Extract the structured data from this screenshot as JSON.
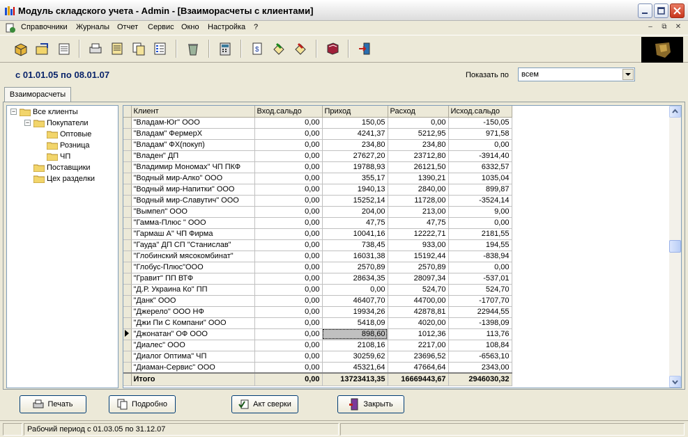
{
  "window": {
    "title": "Модуль складского учета - Admin - [Взаиморасчеты с клиентами]"
  },
  "menu": {
    "items": [
      "Справочники",
      "Журналы",
      "Отчет",
      "Сервис",
      "Окно",
      "Настройка",
      "?"
    ]
  },
  "period": {
    "text": "с 01.01.05 по 08.01.07",
    "show_label": "Показать по",
    "show_value": "всем"
  },
  "tab": {
    "label": "Взаиморасчеты"
  },
  "tree": {
    "root": "Все клиенты",
    "nodes": [
      "Покупатели",
      "Оптовые",
      "Розница",
      "ЧП",
      "Поставщики",
      "Цех разделки"
    ]
  },
  "grid": {
    "columns": [
      "Клиент",
      "Вход.сальдо",
      "Приход",
      "Расход",
      "Исход.сальдо"
    ],
    "rows": [
      [
        "\"Владам-Юг\" ООО",
        "0,00",
        "150,05",
        "0,00",
        "-150,05"
      ],
      [
        "\"Владам\" ФермерХ",
        "0,00",
        "4241,37",
        "5212,95",
        "971,58"
      ],
      [
        "\"Владам\" ФХ(покуп)",
        "0,00",
        "234,80",
        "234,80",
        "0,00"
      ],
      [
        "\"Владен\" ДП",
        "0,00",
        "27627,20",
        "23712,80",
        "-3914,40"
      ],
      [
        "\"Владимир Мономах\" ЧП ПКФ",
        "0,00",
        "19788,93",
        "26121,50",
        "6332,57"
      ],
      [
        "\"Водный мир-Алко\" ООО",
        "0,00",
        "355,17",
        "1390,21",
        "1035,04"
      ],
      [
        "\"Водный мир-Напитки\" ООО",
        "0,00",
        "1940,13",
        "2840,00",
        "899,87"
      ],
      [
        "\"Водный мир-Славутич\" ООО",
        "0,00",
        "15252,14",
        "11728,00",
        "-3524,14"
      ],
      [
        "\"Вымпел\" ООО",
        "0,00",
        "204,00",
        "213,00",
        "9,00"
      ],
      [
        "\"Гамма-Плюс \" ООО",
        "0,00",
        "47,75",
        "47,75",
        "0,00"
      ],
      [
        "\"Гармаш А\" ЧП Фирма",
        "0,00",
        "10041,16",
        "12222,71",
        "2181,55"
      ],
      [
        "\"Гауда\" ДП СП \"Станислав\"",
        "0,00",
        "738,45",
        "933,00",
        "194,55"
      ],
      [
        "\"Глобинский мясокомбинат\"",
        "0,00",
        "16031,38",
        "15192,44",
        "-838,94"
      ],
      [
        "\"Глобус-Плюс\"ООО",
        "0,00",
        "2570,89",
        "2570,89",
        "0,00"
      ],
      [
        "\"Гравит\" ПП ВТФ",
        "0,00",
        "28634,35",
        "28097,34",
        "-537,01"
      ],
      [
        "\"Д.Р. Украина Ко\" ПП",
        "0,00",
        "0,00",
        "524,70",
        "524,70"
      ],
      [
        "\"Данк\" ООО",
        "0,00",
        "46407,70",
        "44700,00",
        "-1707,70"
      ],
      [
        "\"Джерело\" ООО НФ",
        "0,00",
        "19934,26",
        "42878,81",
        "22944,55"
      ],
      [
        "\"Джи Пи С Компани\" ООО",
        "0,00",
        "5418,09",
        "4020,00",
        "-1398,09"
      ],
      [
        "\"Джонатан\" ОФ ООО",
        "0,00",
        "898,60",
        "1012,36",
        "113,76"
      ],
      [
        "\"Диалес\" ООО",
        "0,00",
        "2108,16",
        "2217,00",
        "108,84"
      ],
      [
        "\"Диалог Оптима\" ЧП",
        "0,00",
        "30259,62",
        "23696,52",
        "-6563,10"
      ],
      [
        "\"Диаман-Сервис\" ООО",
        "0,00",
        "45321,64",
        "47664,64",
        "2343,00"
      ]
    ],
    "selected_row": 19,
    "total": [
      "Итого",
      "0,00",
      "13723413,35",
      "16669443,67",
      "2946030,32"
    ]
  },
  "buttons": {
    "print": "Печать",
    "details": "Подробно",
    "reconcile": "Акт сверки",
    "close": "Закрыть"
  },
  "status": {
    "text": "Рабочий период с 01.03.05 по 31.12.07"
  }
}
